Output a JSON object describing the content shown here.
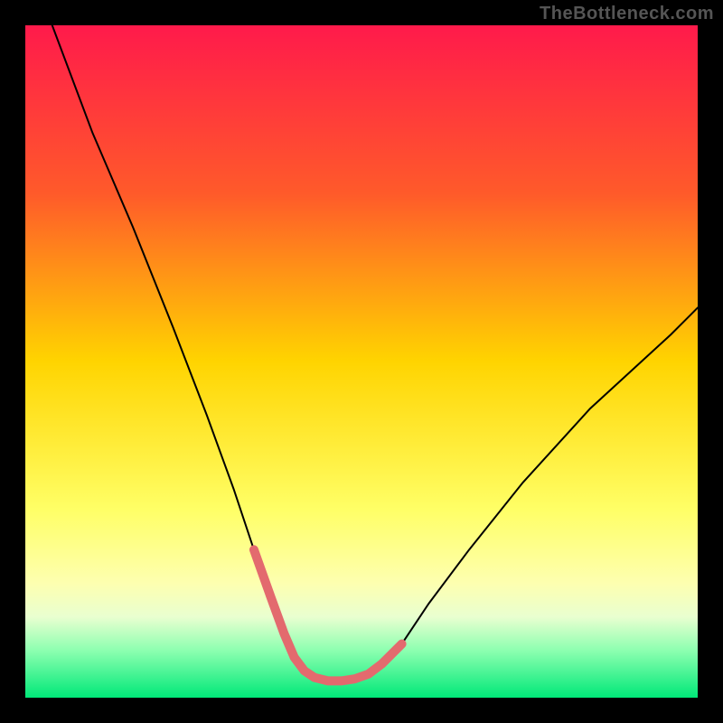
{
  "watermark": "TheBottleneck.com",
  "chart_data": {
    "type": "line",
    "title": "",
    "xlabel": "",
    "ylabel": "",
    "xlim": [
      0,
      100
    ],
    "ylim": [
      0,
      100
    ],
    "background_gradient": {
      "stops": [
        {
          "offset": 0,
          "color": "#ff1a4b"
        },
        {
          "offset": 25,
          "color": "#ff5a2a"
        },
        {
          "offset": 50,
          "color": "#ffd400"
        },
        {
          "offset": 72,
          "color": "#ffff66"
        },
        {
          "offset": 83,
          "color": "#fdffb0"
        },
        {
          "offset": 88,
          "color": "#e9ffd0"
        },
        {
          "offset": 93,
          "color": "#8cffb0"
        },
        {
          "offset": 100,
          "color": "#00e878"
        }
      ]
    },
    "series": [
      {
        "name": "bottleneck-curve",
        "color": "#000000",
        "stroke_width": 2,
        "x": [
          4,
          10,
          16,
          22,
          27,
          31,
          34,
          36.5,
          38.5,
          40,
          41.5,
          43,
          45,
          47,
          49,
          51,
          53,
          56,
          60,
          66,
          74,
          84,
          96,
          100
        ],
        "y": [
          100,
          84,
          70,
          55,
          42,
          31,
          22,
          15,
          9.5,
          6,
          4,
          3,
          2.5,
          2.5,
          2.8,
          3.5,
          5,
          8,
          14,
          22,
          32,
          43,
          54,
          58
        ]
      },
      {
        "name": "optimal-band-marker",
        "color": "#e36a6e",
        "stroke_width": 10,
        "linecap": "round",
        "x": [
          34,
          36.5,
          38.5,
          40,
          41.5,
          43,
          45,
          47,
          49,
          51,
          53,
          56
        ],
        "y": [
          22,
          15,
          9.5,
          6,
          4,
          3,
          2.5,
          2.5,
          2.8,
          3.5,
          5,
          8
        ]
      }
    ]
  }
}
